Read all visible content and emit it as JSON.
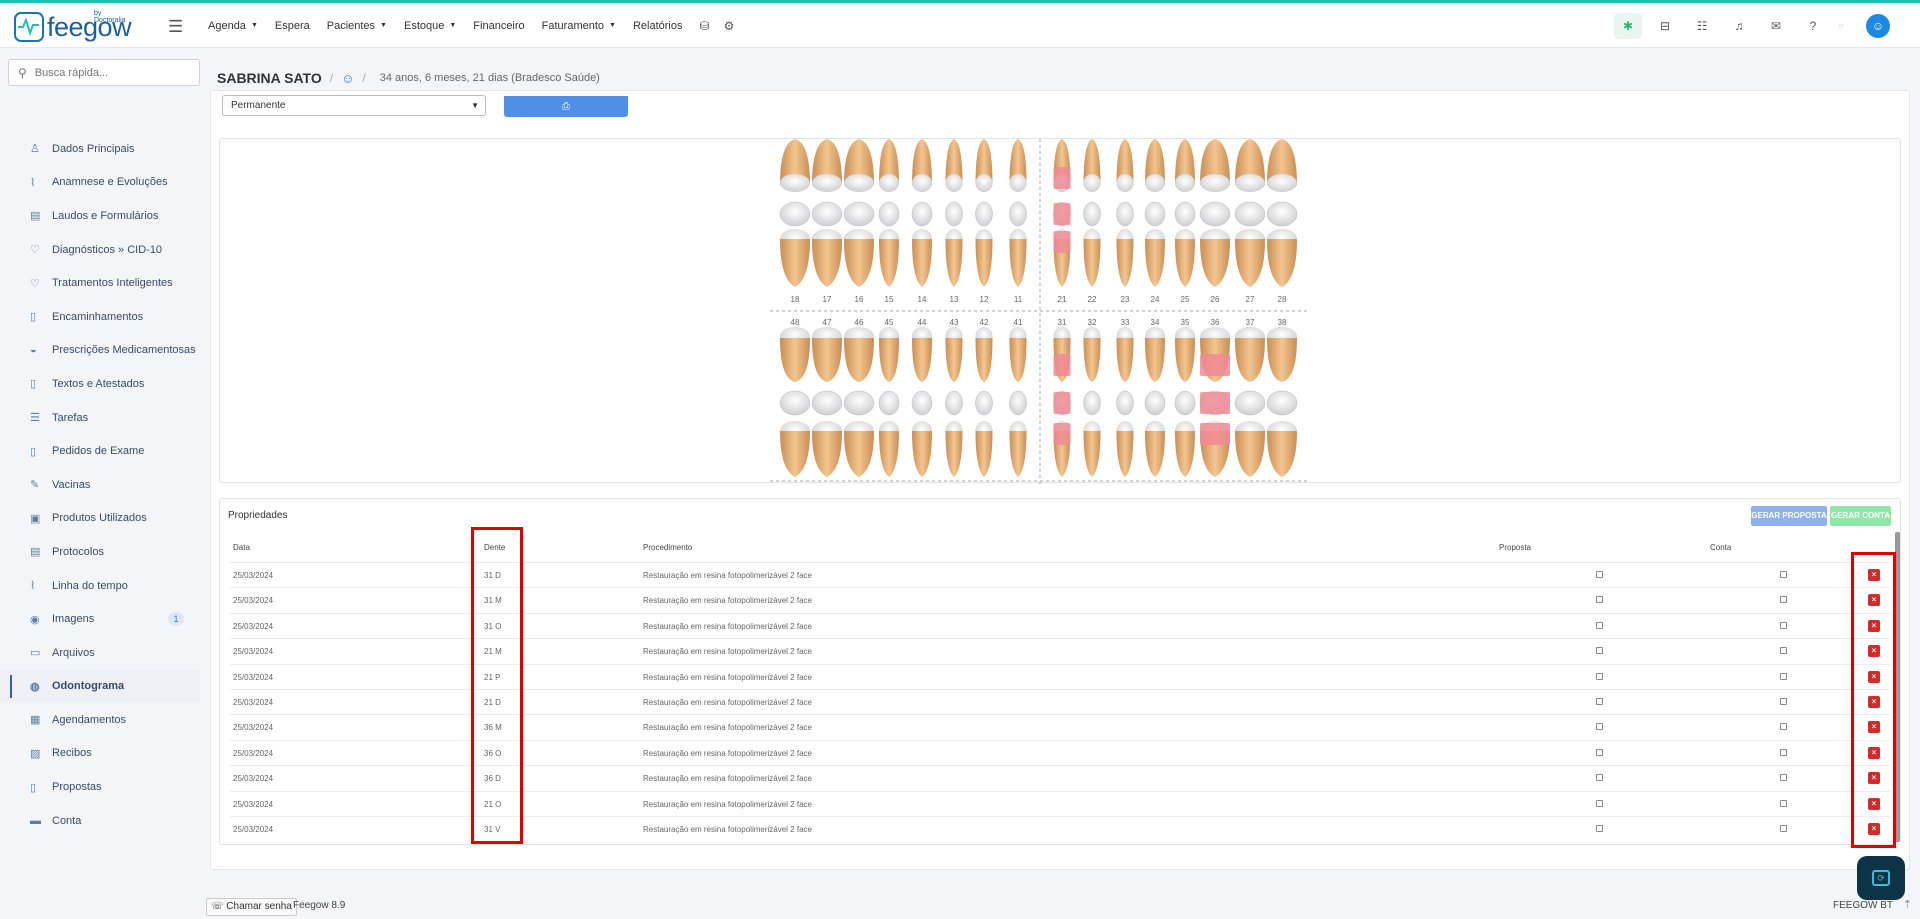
{
  "brand": {
    "name": "feegow",
    "by": "by Doctoralia"
  },
  "nav": [
    {
      "label": "Agenda",
      "dropdown": true
    },
    {
      "label": "Espera",
      "dropdown": false
    },
    {
      "label": "Pacientes",
      "dropdown": true
    },
    {
      "label": "Estoque",
      "dropdown": true
    },
    {
      "label": "Financeiro",
      "dropdown": false
    },
    {
      "label": "Faturamento",
      "dropdown": true
    },
    {
      "label": "Relatórios",
      "dropdown": false
    }
  ],
  "search": {
    "placeholder": "Busca rápida..."
  },
  "sidebar": {
    "items": [
      {
        "label": "Dados Principais",
        "icon": "user-icon"
      },
      {
        "label": "Anamnese e Evoluções",
        "icon": "chart-icon"
      },
      {
        "label": "Laudos e Formulários",
        "icon": "clipboard-icon"
      },
      {
        "label": "Diagnósticos » CID-10",
        "icon": "stethoscope-icon"
      },
      {
        "label": "Tratamentos Inteligentes",
        "icon": "stethoscope-icon"
      },
      {
        "label": "Encaminhamentos",
        "icon": "document-icon"
      },
      {
        "label": "Prescrições Medicamentosas",
        "icon": "pills-icon"
      },
      {
        "label": "Textos e Atestados",
        "icon": "document-icon"
      },
      {
        "label": "Tarefas",
        "icon": "list-icon"
      },
      {
        "label": "Pedidos de Exame",
        "icon": "document-icon"
      },
      {
        "label": "Vacinas",
        "icon": "syringe-icon"
      },
      {
        "label": "Produtos Utilizados",
        "icon": "box-icon"
      },
      {
        "label": "Protocolos",
        "icon": "clipboard-icon"
      },
      {
        "label": "Linha do tempo",
        "icon": "chart-icon"
      },
      {
        "label": "Imagens",
        "icon": "camera-icon",
        "badge": "1"
      },
      {
        "label": "Arquivos",
        "icon": "file-icon"
      },
      {
        "label": "Odontograma",
        "icon": "globe-icon",
        "active": true
      },
      {
        "label": "Agendamentos",
        "icon": "calendar-icon"
      },
      {
        "label": "Recibos",
        "icon": "receipt-icon"
      },
      {
        "label": "Propostas",
        "icon": "document-icon"
      },
      {
        "label": "Conta",
        "icon": "money-icon"
      }
    ]
  },
  "patient": {
    "name": "SABRINA SATO",
    "info": "34 anos, 6 meses, 21 dias (Bradesco Saúde)"
  },
  "controls": {
    "select_value": "Permanente"
  },
  "odontogram": {
    "upper_numbers": [
      "18",
      "17",
      "16",
      "15",
      "14",
      "13",
      "12",
      "11",
      "21",
      "22",
      "23",
      "24",
      "25",
      "26",
      "27",
      "28"
    ],
    "lower_numbers": [
      "48",
      "47",
      "46",
      "45",
      "44",
      "43",
      "42",
      "41",
      "31",
      "32",
      "33",
      "34",
      "35",
      "36",
      "37",
      "38"
    ],
    "marked_upper": [
      "21"
    ],
    "marked_lower": [
      "31",
      "36"
    ],
    "mark_color": "#f08a94"
  },
  "properties": {
    "title": "Propriedades",
    "btn_proposta": "GERAR PROPOSTA",
    "btn_conta": "GERAR CONTA",
    "headers": {
      "data": "Data",
      "dente": "Dente",
      "procedimento": "Procedimento",
      "proposta": "Proposta",
      "conta": "Conta"
    },
    "rows": [
      {
        "data": "25/03/2024",
        "dente": "31 D",
        "procedimento": "Restauração em resina fotopolimerizável 2 face"
      },
      {
        "data": "25/03/2024",
        "dente": "31 M",
        "procedimento": "Restauração em resina fotopolimerizável 2 face"
      },
      {
        "data": "25/03/2024",
        "dente": "31 O",
        "procedimento": "Restauração em resina fotopolimerizável 2 face"
      },
      {
        "data": "25/03/2024",
        "dente": "21 M",
        "procedimento": "Restauração em resina fotopolimerizável 2 face"
      },
      {
        "data": "25/03/2024",
        "dente": "21 P",
        "procedimento": "Restauração em resina fotopolimerizável 2 face"
      },
      {
        "data": "25/03/2024",
        "dente": "21 D",
        "procedimento": "Restauração em resina fotopolimerizável 2 face"
      },
      {
        "data": "25/03/2024",
        "dente": "36 M",
        "procedimento": "Restauração em resina fotopolimerizável 2 face"
      },
      {
        "data": "25/03/2024",
        "dente": "36 O",
        "procedimento": "Restauração em resina fotopolimerizável 2 face"
      },
      {
        "data": "25/03/2024",
        "dente": "36 D",
        "procedimento": "Restauração em resina fotopolimerizável 2 face"
      },
      {
        "data": "25/03/2024",
        "dente": "21 O",
        "procedimento": "Restauração em resina fotopolimerizável 2 face"
      },
      {
        "data": "25/03/2024",
        "dente": "31 V",
        "procedimento": "Restauração em resina fotopolimerizável 2 face"
      }
    ]
  },
  "footer": {
    "chamar": "Chamar senha",
    "version": "Feegow 8.9",
    "brand_right": "FEEGOW BT"
  },
  "colors": {
    "accent": "#1dbfb1",
    "primary": "#4f8fe6",
    "danger": "#d42a2a",
    "highlight": "#e00000"
  }
}
